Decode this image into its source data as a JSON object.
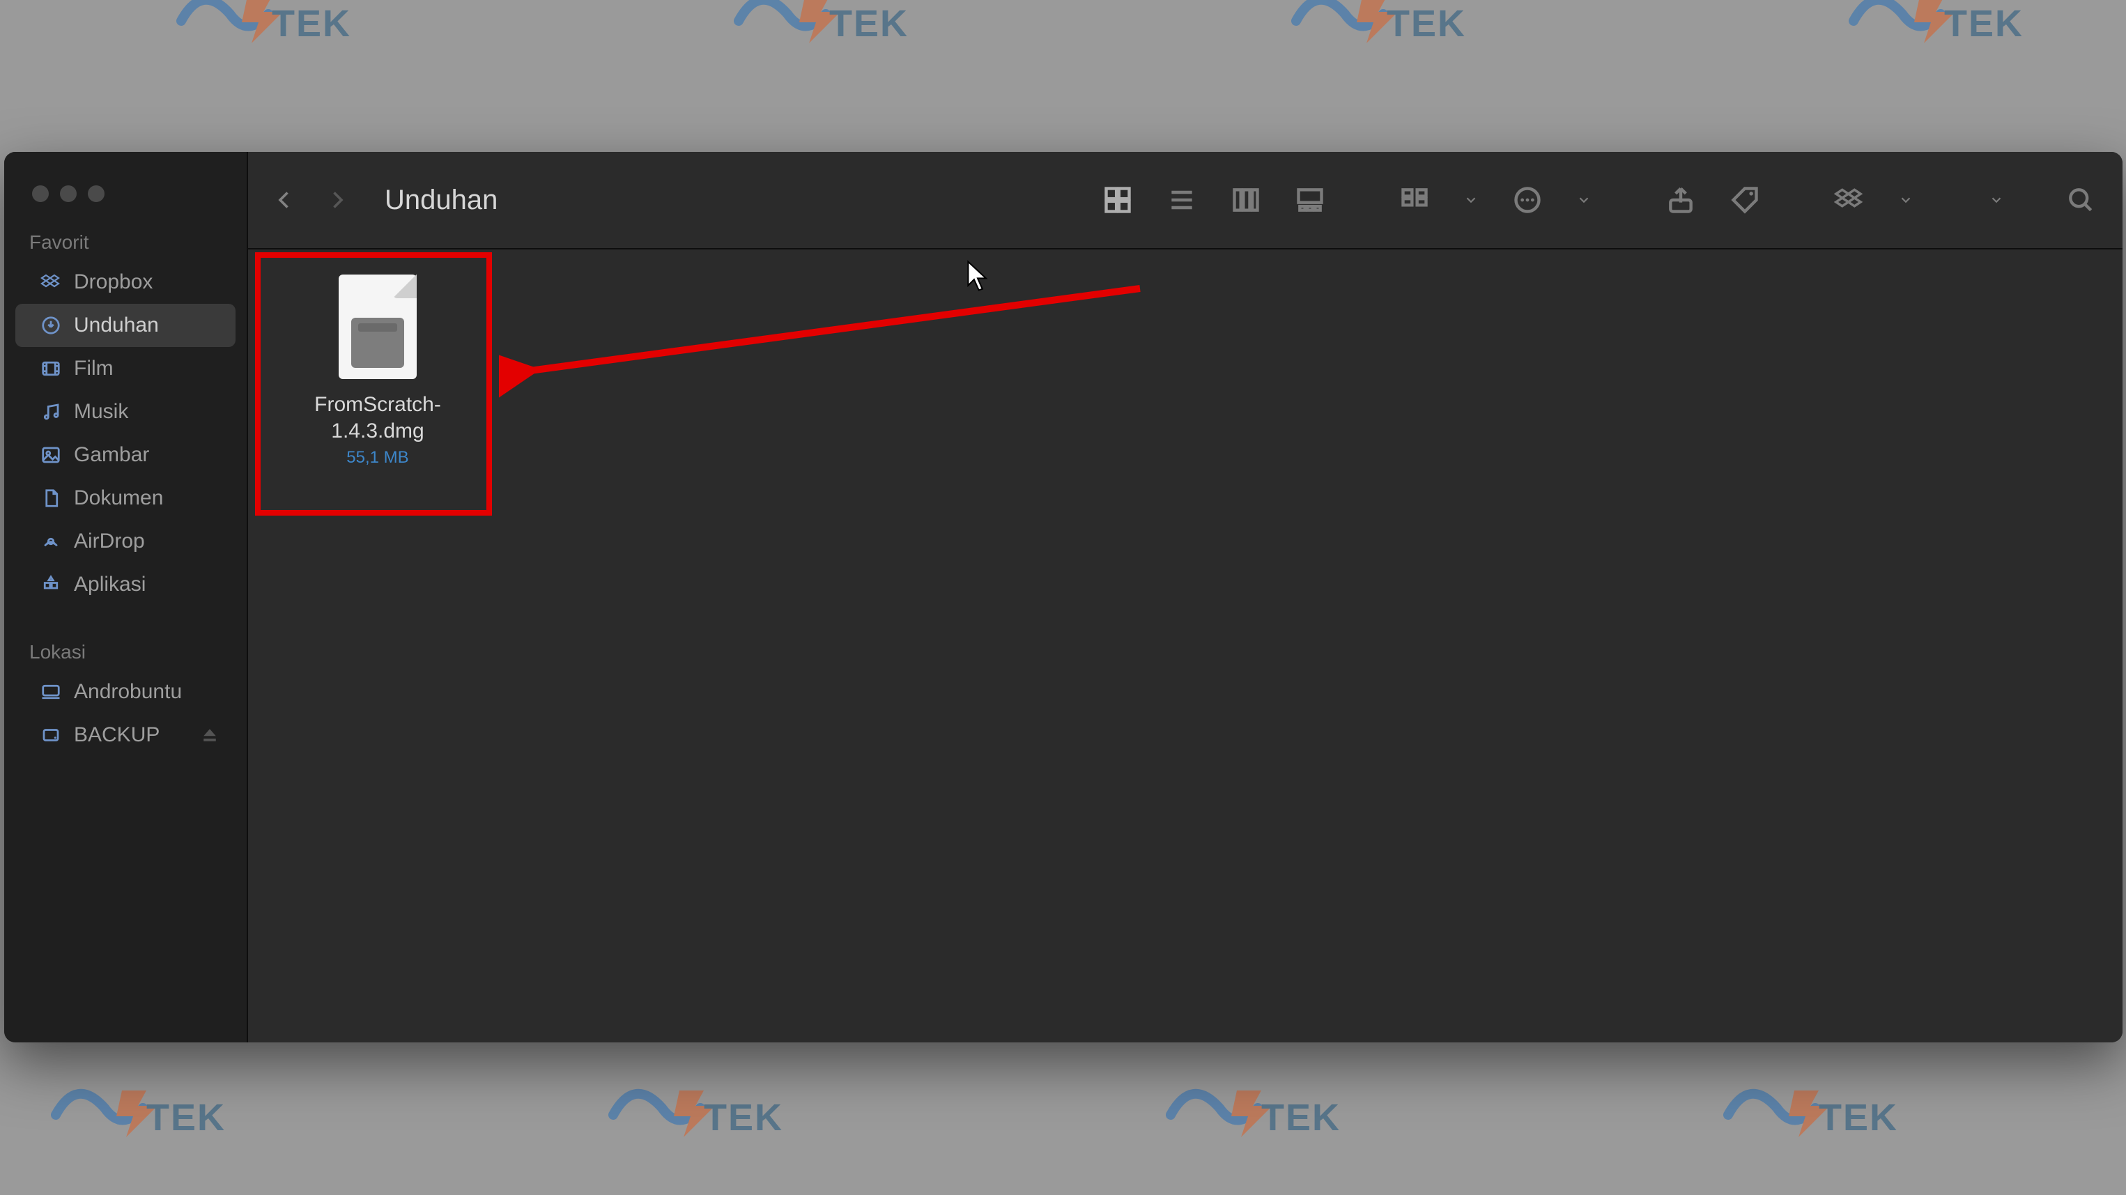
{
  "toolbar": {
    "title": "Unduhan"
  },
  "sidebar": {
    "sections": [
      {
        "label": "Favorit",
        "items": [
          "Dropbox",
          "Unduhan",
          "Film",
          "Musik",
          "Gambar",
          "Dokumen",
          "AirDrop",
          "Aplikasi"
        ]
      },
      {
        "label": "Lokasi",
        "items": [
          "Androbuntu",
          "BACKUP"
        ]
      }
    ],
    "active_item": "Unduhan"
  },
  "files": [
    {
      "name": "FromScratch-1.4.3.dmg",
      "size": "55,1 MB"
    }
  ],
  "annotation": {
    "highlight_color": "#e30000",
    "target": "files.0"
  }
}
